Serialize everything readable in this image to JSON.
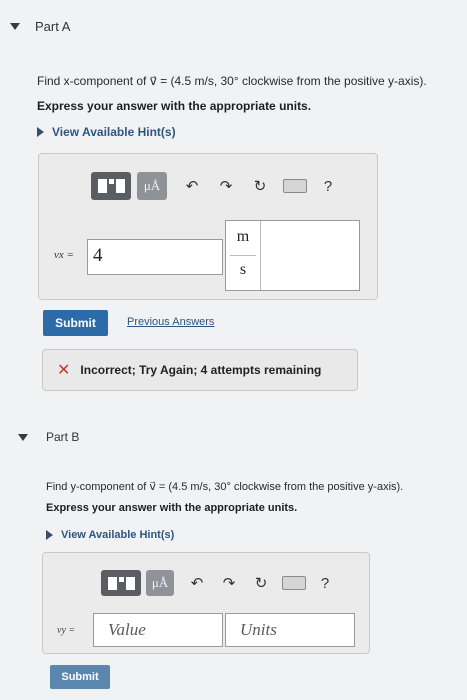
{
  "part_a": {
    "title": "Part A",
    "question": "Find x-component of v⃗ = (4.5 m/s, 30° clockwise from the positive y-axis).",
    "instruction": "Express your answer with the appropriate units.",
    "hints_label": "View Available Hint(s)",
    "variable_label": "vx =",
    "value": "4",
    "unit_numerator": "m",
    "unit_denominator": "s",
    "submit_label": "Submit",
    "previous_answers_label": "Previous Answers",
    "feedback": "Incorrect; Try Again; 4 attempts remaining"
  },
  "part_b": {
    "title": "Part B",
    "question": "Find y-component of v⃗ = (4.5 m/s, 30° clockwise from the positive y-axis).",
    "instruction": "Express your answer with the appropriate units.",
    "hints_label": "View Available Hint(s)",
    "variable_label": "vy =",
    "value_placeholder": "Value",
    "units_placeholder": "Units",
    "submit_label": "Submit"
  },
  "toolbar": {
    "units_button": "μÅ",
    "help_label": "?",
    "icons": [
      "templates-icon",
      "units-icon",
      "undo-icon",
      "redo-icon",
      "reset-icon",
      "keyboard-icon",
      "help-icon"
    ]
  },
  "colors": {
    "submit": "#2c6aa8",
    "link": "#2f5580",
    "incorrect": "#c23b2a"
  }
}
